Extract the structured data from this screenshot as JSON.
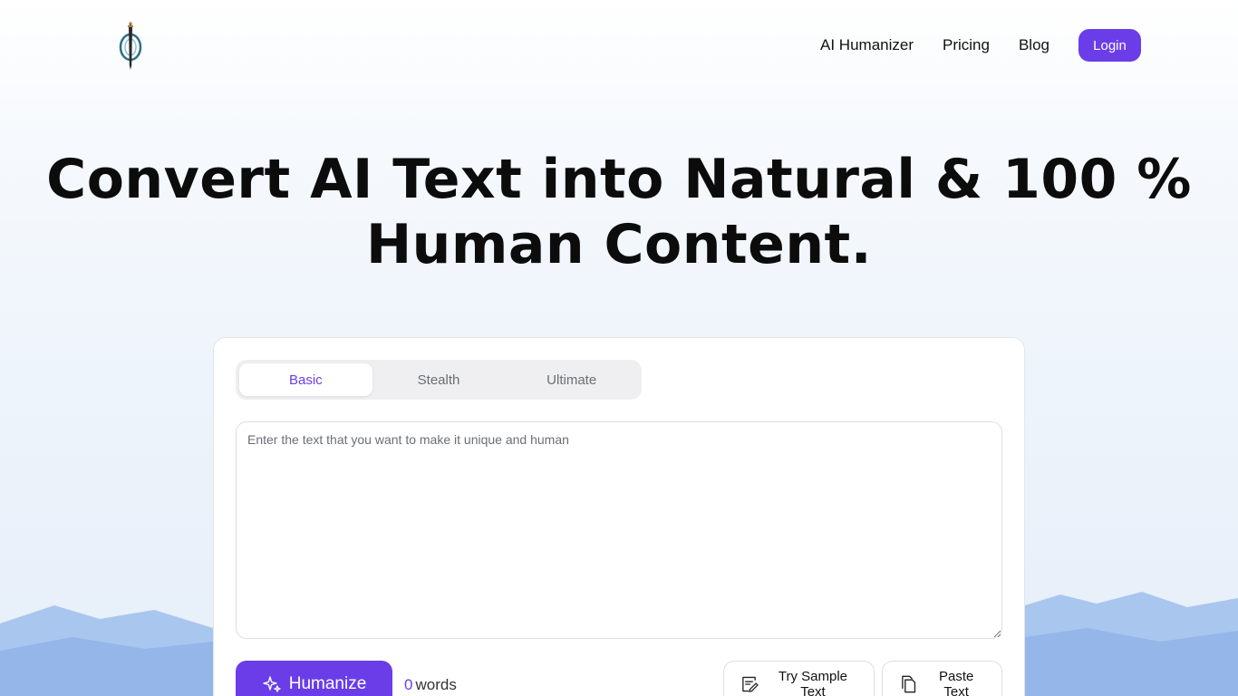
{
  "nav": {
    "links": [
      "AI Humanizer",
      "Pricing",
      "Blog"
    ],
    "login_label": "Login"
  },
  "hero": {
    "title_line1": "Convert AI Text into Natural & 100 %",
    "title_line2": "Human Content."
  },
  "editor": {
    "tabs": [
      "Basic",
      "Stealth",
      "Ultimate"
    ],
    "active_tab": "Basic",
    "placeholder": "Enter the text that you want to make it unique and human",
    "value": "",
    "humanize_label": "Humanize",
    "word_count": "0",
    "word_count_unit": "words",
    "sample_label": "Try Sample Text",
    "paste_label": "Paste Text"
  },
  "colors": {
    "accent": "#6a3de8",
    "mountain": "#a9c6ee"
  },
  "icons": {
    "logo": "compass-sword-logo",
    "humanize": "sparkles-icon",
    "sample": "edit-document-icon",
    "paste": "copy-icon"
  }
}
